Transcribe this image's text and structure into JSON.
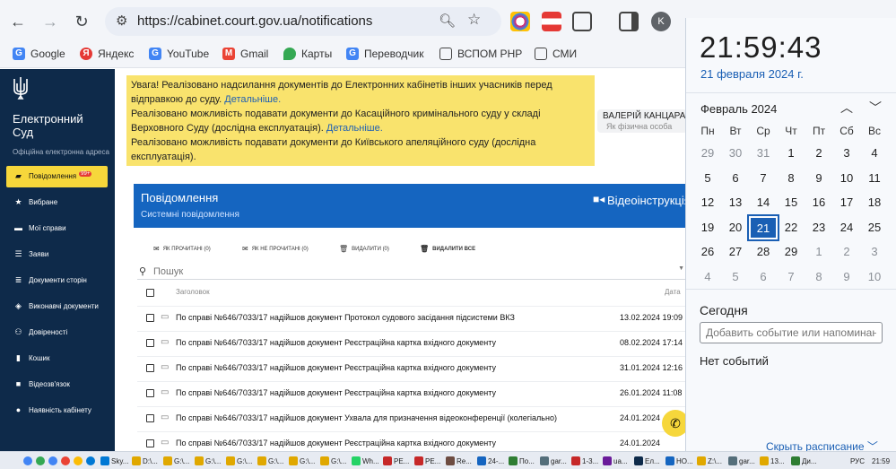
{
  "browser": {
    "url": "https://cabinet.court.gov.ua/notifications",
    "profile_initial": "K",
    "bookmarks": [
      {
        "label": "Google",
        "color": "#4285f4",
        "glyph": "G"
      },
      {
        "label": "Яндекс",
        "color": "#e53935",
        "glyph": "Я"
      },
      {
        "label": "YouTube",
        "color": "#4285f4",
        "glyph": "G"
      },
      {
        "label": "Gmail",
        "color": "#ea4335",
        "glyph": "M"
      },
      {
        "label": "Карты",
        "color": "#34a853",
        "glyph": "◉"
      },
      {
        "label": "Переводчик",
        "color": "#4285f4",
        "glyph": "G"
      },
      {
        "label": "ВСПОМ РНР",
        "color": "#555",
        "glyph": ""
      },
      {
        "label": "СМИ",
        "color": "#555",
        "glyph": ""
      }
    ]
  },
  "sidebar": {
    "brand": "Електронний Суд",
    "brand_sub": "Офіційна електронна адреса",
    "items": [
      {
        "label": "Повідомлення",
        "icon": "bell-icon",
        "badge": "99+"
      },
      {
        "label": "Вибране",
        "icon": "star-icon"
      },
      {
        "label": "Мої справи",
        "icon": "folder-icon"
      },
      {
        "label": "Заяви",
        "icon": "list-icon"
      },
      {
        "label": "Документи сторін",
        "icon": "doc-list-icon"
      },
      {
        "label": "Виконавчі документи",
        "icon": "stack-icon"
      },
      {
        "label": "Довіреності",
        "icon": "people-icon"
      },
      {
        "label": "Кошик",
        "icon": "trash-icon"
      },
      {
        "label": "Відеозв'язок",
        "icon": "video-icon"
      },
      {
        "label": "Наявність кабінету",
        "icon": "person-icon"
      }
    ]
  },
  "notice": {
    "line1": "Увага! Реалізовано надсилання документів до Електронних кабінетів інших учасників перед відправкою до суду.",
    "link1": "Детальніше.",
    "line2": "Реалізовано можливість подавати документи до Касаційного кримінального суду у складі Верховного Суду (дослідна експлуатація).",
    "link2": "Детальніше.",
    "line3": "Реалізовано можливість подавати документи до Київського апеляційного суду (дослідна експлуатація)."
  },
  "user": {
    "name": "ВАЛЕРІЙ КАНЦАРА",
    "role": "Як фізична особа"
  },
  "messages": {
    "title": "Повідомлення",
    "subtitle": "Системні повідомлення",
    "video_label": "Відеоінструкція",
    "actions": {
      "read": "ЯК ПРОЧИТАНІ (0)",
      "unread": "ЯК НЕ ПРОЧИТАНІ (0)",
      "delete": "ВИДАЛИТИ (0)",
      "delete_all": "ВИДАЛИТИ ВСЕ"
    },
    "search_placeholder": "Пошук",
    "col_title": "Заголовок",
    "col_date": "Дата",
    "rows": [
      {
        "subject": "По справі №646/7033/17 надійшов документ Протокол судового засідання підсистеми ВКЗ",
        "date": "13.02.2024 19:09"
      },
      {
        "subject": "По справі №646/7033/17 надійшов документ Реєстраційна картка вхідного документу",
        "date": "08.02.2024 17:14"
      },
      {
        "subject": "По справі №646/7033/17 надійшов документ Реєстраційна картка вхідного документу",
        "date": "31.01.2024 12:16"
      },
      {
        "subject": "По справі №646/7033/17 надійшов документ Реєстраційна картка вхідного документу",
        "date": "26.01.2024 11:08"
      },
      {
        "subject": "По справі №646/7033/17 надійшов документ Ухвала для призначення відеоконференції (колегіально)",
        "date": "24.01.2024"
      },
      {
        "subject": "По справі №646/7033/17 надійшов документ Реєстраційна картка вхідного документу",
        "date": "24.01.2024"
      }
    ]
  },
  "calendar": {
    "time": "21:59:43",
    "date": "21 февраля 2024 г.",
    "month": "Февраль 2024",
    "weekdays": [
      "Пн",
      "Вт",
      "Ср",
      "Чт",
      "Пт",
      "Сб",
      "Вс"
    ],
    "days": [
      [
        "29",
        "30",
        "31",
        "1",
        "2",
        "3",
        "4"
      ],
      [
        "5",
        "6",
        "7",
        "8",
        "9",
        "10",
        "11"
      ],
      [
        "12",
        "13",
        "14",
        "15",
        "16",
        "17",
        "18"
      ],
      [
        "19",
        "20",
        "21",
        "22",
        "23",
        "24",
        "25"
      ],
      [
        "26",
        "27",
        "28",
        "29",
        "1",
        "2",
        "3"
      ],
      [
        "4",
        "5",
        "6",
        "7",
        "8",
        "9",
        "10"
      ]
    ],
    "today": "Сегодня",
    "event_placeholder": "Добавить событие или напоминание",
    "no_events": "Нет событий",
    "hide_schedule": "Скрыть расписание"
  },
  "taskbar": {
    "items": [
      "Sky...",
      "D:\\...",
      "G:\\...",
      "G:\\...",
      "G:\\...",
      "G:\\...",
      "G:\\...",
      "G:\\...",
      "Wh...",
      "PE...",
      "PE...",
      "Re...",
      "24-...",
      "По...",
      "gar...",
      "1-3...",
      "ua...",
      "Ел...",
      "НО...",
      "Z:\\...",
      "gar...",
      "13...",
      "Ди..."
    ],
    "lang": "РУС",
    "clock": "21:59"
  }
}
